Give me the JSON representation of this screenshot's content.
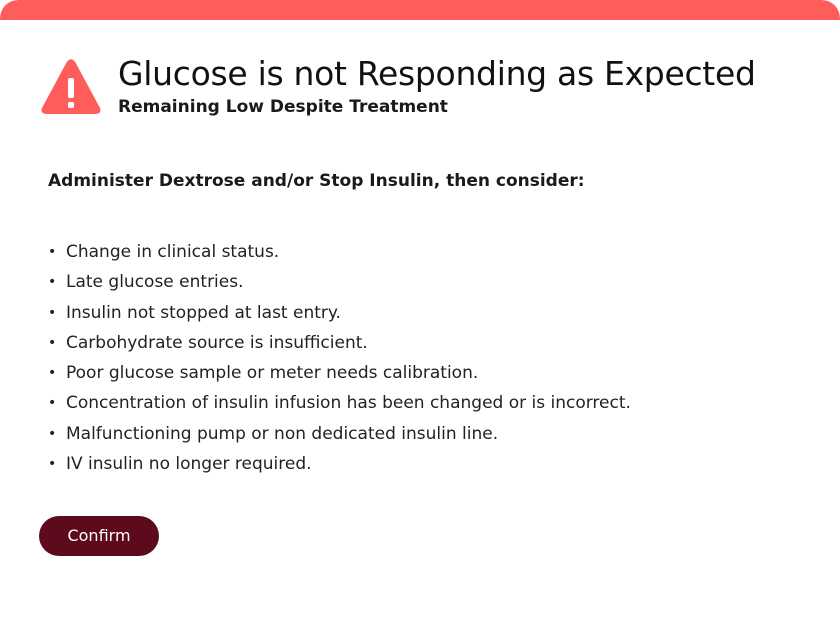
{
  "colors": {
    "accent_bar": "#ff5c5c",
    "warning_icon": "#ff5c5c",
    "confirm_button": "#5c0a1c",
    "confirm_text": "#ffffff"
  },
  "header": {
    "icon": "warning-triangle-icon",
    "title": "Glucose is not Responding as Expected",
    "subtitle": "Remaining Low Despite Treatment"
  },
  "body": {
    "instruction": "Administer Dextrose and/or Stop Insulin, then consider:",
    "items": [
      "Change in clinical status.",
      "Late glucose entries.",
      "Insulin not stopped at last entry.",
      "Carbohydrate source is insufficient.",
      "Poor glucose sample or meter needs calibration.",
      "Concentration of insulin infusion has been changed or is incorrect.",
      "Malfunctioning pump or non dedicated insulin line.",
      "IV insulin no longer required."
    ]
  },
  "actions": {
    "confirm_label": "Confirm"
  }
}
